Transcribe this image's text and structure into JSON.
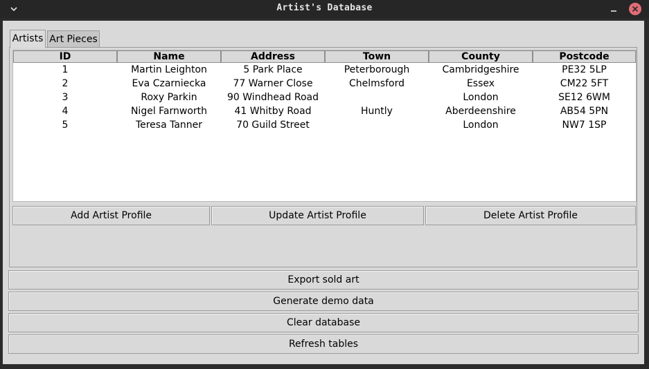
{
  "window": {
    "title": "Artist's Database"
  },
  "tabs": [
    {
      "label": "Artists",
      "active": true
    },
    {
      "label": "Art Pieces",
      "active": false
    }
  ],
  "table": {
    "columns": [
      "ID",
      "Name",
      "Address",
      "Town",
      "County",
      "Postcode"
    ],
    "rows": [
      [
        "1",
        "Martin Leighton",
        "5 Park Place",
        "Peterborough",
        "Cambridgeshire",
        "PE32 5LP"
      ],
      [
        "2",
        "Eva Czarniecka",
        "77 Warner Close",
        "Chelmsford",
        "Essex",
        "CM22 5FT"
      ],
      [
        "3",
        "Roxy Parkin",
        "90 Windhead Road",
        "",
        "London",
        "SE12 6WM"
      ],
      [
        "4",
        "Nigel Farnworth",
        "41 Whitby Road",
        "Huntly",
        "Aberdeenshire",
        "AB54 5PN"
      ],
      [
        "5",
        "Teresa Tanner",
        "70 Guild Street",
        "",
        "London",
        "NW7 1SP"
      ]
    ]
  },
  "artist_buttons": {
    "add": "Add Artist Profile",
    "update": "Update Artist Profile",
    "delete": "Delete Artist Profile"
  },
  "main_buttons": {
    "export": "Export sold art",
    "demo": "Generate demo data",
    "clear": "Clear database",
    "refresh": "Refresh tables"
  },
  "icons": {
    "menu": "chevron-down-icon",
    "minimize": "minimize-icon",
    "close": "close-icon"
  },
  "colors": {
    "titlebar": "#262626",
    "client": "#d9d9d9",
    "close_button": "#e06c75"
  }
}
